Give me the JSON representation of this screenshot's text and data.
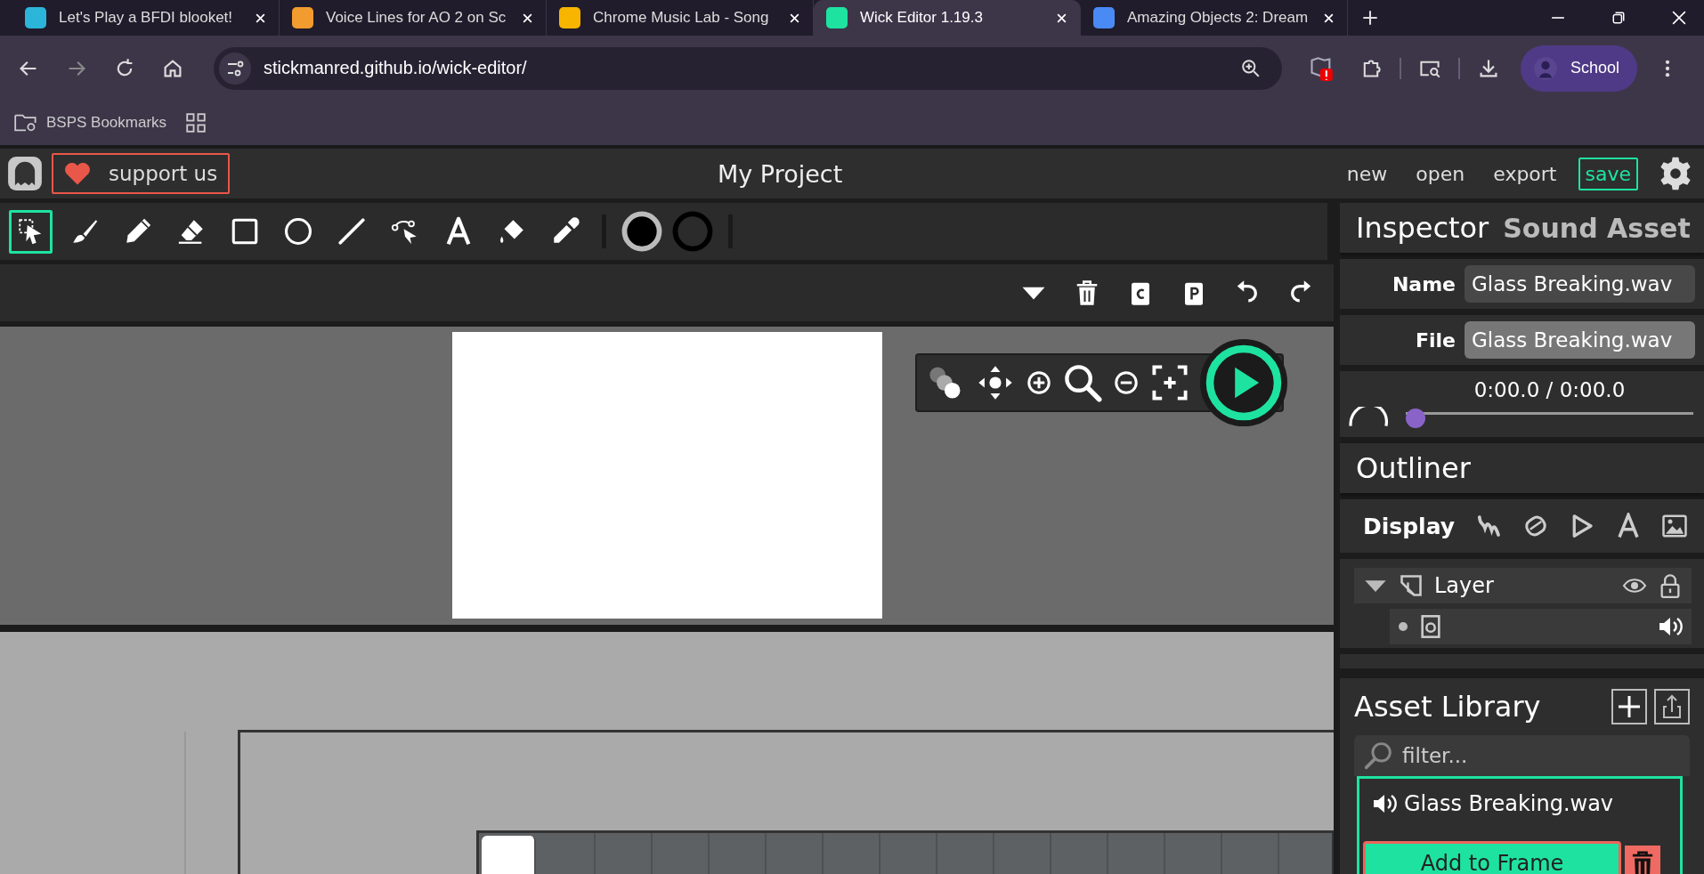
{
  "browser": {
    "tabs": [
      {
        "title": "Let's Play a BFDI blooket!",
        "selected": false
      },
      {
        "title": "Voice Lines for AO 2 on Sc",
        "selected": false
      },
      {
        "title": "Chrome Music Lab - Song",
        "selected": false
      },
      {
        "title": "Wick Editor 1.19.3",
        "selected": true
      },
      {
        "title": "Amazing Objects 2: Dream",
        "selected": false
      }
    ],
    "url": "stickmanred.github.io/wick-editor/",
    "profile": "School",
    "bookmarks": [
      "BSPS Bookmarks"
    ]
  },
  "app": {
    "support": "support us",
    "project_title": "My Project",
    "menu": [
      {
        "label": "new",
        "kind": "link"
      },
      {
        "label": "open",
        "kind": "link"
      },
      {
        "label": "export",
        "kind": "link"
      },
      {
        "label": "save",
        "kind": "primary"
      }
    ],
    "tools": [
      {
        "kind": "select",
        "selected": true
      },
      {
        "kind": "brush",
        "selected": false
      },
      {
        "kind": "pencil",
        "selected": false
      },
      {
        "kind": "eraser",
        "selected": false
      },
      {
        "kind": "rectangle",
        "selected": false
      },
      {
        "kind": "ellipse",
        "selected": false
      },
      {
        "kind": "line",
        "selected": false
      },
      {
        "kind": "path",
        "selected": false
      },
      {
        "kind": "text",
        "selected": false
      },
      {
        "kind": "fill",
        "selected": false
      },
      {
        "kind": "eyedropper",
        "selected": false
      }
    ],
    "inspector": {
      "title": "Inspector",
      "subtitle": "Sound Asset",
      "fields": [
        {
          "label": "Name",
          "value": "Glass Breaking.wav",
          "disabled": false
        },
        {
          "label": "File",
          "value": "Glass Breaking.wav",
          "disabled": true
        }
      ],
      "time": "0:00.0 / 0:00.0",
      "level": 0
    },
    "outliner": {
      "title": "Outliner",
      "display_label": "Display",
      "layers": [
        {
          "name": "Layer",
          "expanded": true
        }
      ]
    },
    "asset_library": {
      "title": "Asset Library",
      "filter_placeholder": "filter...",
      "assets": [
        {
          "name": "Glass Breaking.wav",
          "kind": "sound",
          "selected": true
        }
      ],
      "add_button": "Add to Frame"
    }
  }
}
